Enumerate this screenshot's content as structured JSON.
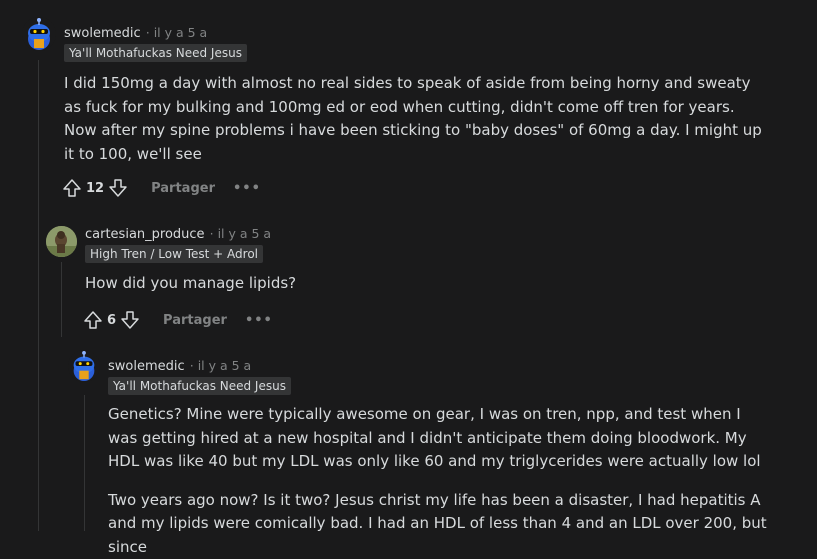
{
  "comments": [
    {
      "username": "swolemedic",
      "time": "· il y a 5 a",
      "flair": "Ya'll Mothafuckas Need Jesus",
      "body": "I did 150mg a day with almost no real sides to speak of aside from being horny and sweaty as fuck for my bulking and 100mg ed or eod when cutting, didn't come off tren for years. Now after my spine problems i have been sticking to \"baby doses\" of 60mg a day. I might up it to 100, we'll see",
      "score": "12",
      "share_label": "Partager",
      "more_label": "•••"
    },
    {
      "username": "cartesian_produce",
      "time": "· il y a 5 a",
      "flair": "High Tren / Low Test + Adrol",
      "body": "How did you manage lipids?",
      "score": "6",
      "share_label": "Partager",
      "more_label": "•••"
    },
    {
      "username": "swolemedic",
      "time": "· il y a 5 a",
      "flair": "Ya'll Mothafuckas Need Jesus",
      "body_paragraphs": [
        "Genetics? Mine were typically awesome on gear, I was on tren, npp, and test when I was getting hired at a new hospital and I didn't anticipate them doing bloodwork. My HDL was like 40 but my LDL was only like 60 and my triglycerides were actually low lol",
        "Two years ago now? Is it two? Jesus christ my life has been a disaster, I had hepatitis A and my lipids were comically bad. I had an HDL of less than 4 and an LDL over 200, but since"
      ]
    }
  ],
  "icons": {
    "upvote": "arrow-up-icon",
    "downvote": "arrow-down-icon",
    "avatar_swolemedic": "snoo-avatar",
    "avatar_cartesian": "dog-avatar"
  }
}
